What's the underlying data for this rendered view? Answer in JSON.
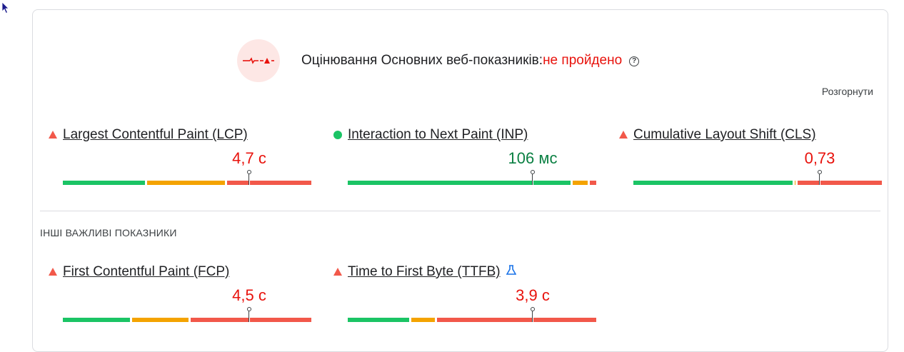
{
  "header": {
    "title": "Оцінювання Основних веб-показників:",
    "status": "не пройдено",
    "help_symbol": "?",
    "icon": "core-web-vitals-failed-icon",
    "expand_label": "Розгорнути",
    "status_color": "#e8120c"
  },
  "other_section": {
    "title": "ІНШІ ВАЖЛИВІ ПОКАЗНИКИ"
  },
  "metrics": [
    {
      "title": "Largest Contentful Paint (LCP)",
      "value": "4,7 с",
      "status": "poor",
      "status_icon": "red-triangle-icon",
      "distribution": {
        "good": 0.338,
        "needs_improvement": 0.323,
        "poor": 0.339
      },
      "marker": 0.75
    },
    {
      "title": "Interaction to Next Paint (INP)",
      "value": "106 мс",
      "status": "good",
      "status_icon": "green-circle-icon",
      "distribution": {
        "good": 0.905,
        "needs_improvement": 0.07,
        "poor": 0.025
      },
      "marker": 0.745
    },
    {
      "title": "Cumulative Layout Shift (CLS)",
      "value": "0,73",
      "status": "poor",
      "status_icon": "red-triangle-icon",
      "distribution": {
        "good": 0.65,
        "needs_improvement": 0.01,
        "poor": 0.34
      },
      "marker": 0.75
    },
    {
      "title": "First Contentful Paint (FCP)",
      "value": "4,5 с",
      "status": "poor",
      "status_icon": "red-triangle-icon",
      "distribution": {
        "good": 0.28,
        "needs_improvement": 0.235,
        "poor": 0.485
      },
      "marker": 0.75
    },
    {
      "title": "Time to First Byte (TTFB)",
      "value": "3,9 с",
      "status": "poor",
      "status_icon": "red-triangle-icon",
      "extra_icon": "experimental-flask-icon",
      "distribution": {
        "good": 0.255,
        "needs_improvement": 0.105,
        "poor": 0.64
      },
      "marker": 0.745
    }
  ],
  "colors": {
    "good": "#1bc465",
    "needs_improvement": "#f4a300",
    "poor": "#f2584a",
    "value_poor": "#e8120c",
    "value_good": "#0b8043"
  }
}
